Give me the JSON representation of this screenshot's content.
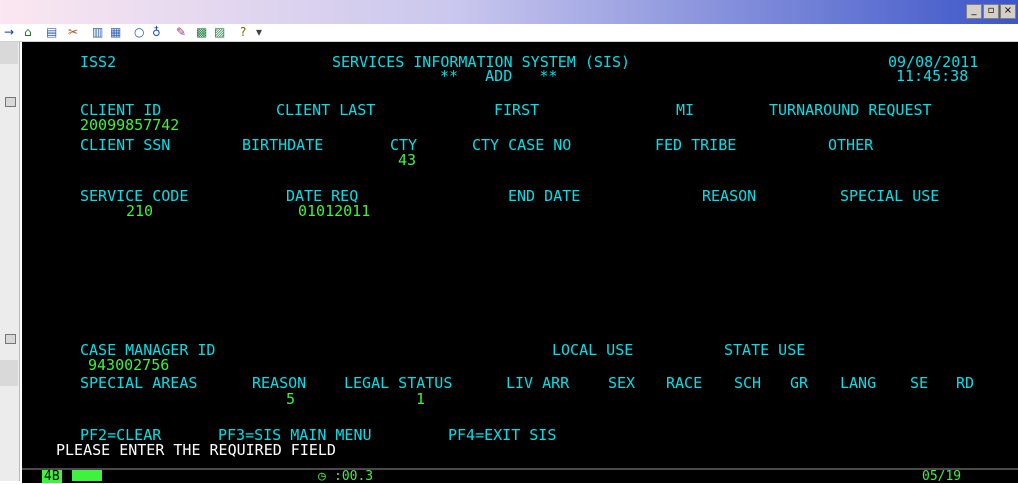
{
  "window": {
    "controls": [
      "_",
      "▫",
      "×"
    ]
  },
  "toolbar": {
    "icons": [
      "back-arrow-icon",
      "home-icon",
      "new-icon",
      "tools-icon",
      "copy-icon",
      "paste-icon",
      "circle-icon",
      "globe-icon",
      "edit-icon",
      "chart-icon",
      "chart2-icon",
      "help-icon",
      "dropdown-icon"
    ],
    "glyphs": [
      "→",
      "⌂",
      "▤",
      "✂",
      "▥",
      "▦",
      "○",
      "♁",
      "✎",
      "▩",
      "▨",
      "?",
      "▾"
    ]
  },
  "colors": {
    "label": "#00e0e8",
    "value": "#3ef23e",
    "message": "#ffffff",
    "screen_bg": "#000000"
  },
  "header": {
    "screen_id": "ISS2",
    "system_title": "SERVICES INFORMATION SYSTEM (SIS)",
    "mode": "**   ADD   **",
    "date": "09/08/2011",
    "time": "11:45:38"
  },
  "client": {
    "id_label": "CLIENT ID",
    "id_value": "20099857742",
    "last_label": "CLIENT LAST",
    "first_label": "FIRST",
    "mi_label": "MI",
    "turnaround_label": "TURNAROUND REQUEST",
    "ssn_label": "CLIENT SSN",
    "birthdate_label": "BIRTHDATE",
    "cty_label": "CTY",
    "cty_value": "43",
    "cty_case_label": "CTY CASE NO",
    "fed_tribe_label": "FED TRIBE",
    "other_label": "OTHER"
  },
  "service": {
    "code_label": "SERVICE CODE",
    "code_value": "210",
    "date_req_label": "DATE REQ",
    "date_req_value": "01012011",
    "end_date_label": "END DATE",
    "reason_label": "REASON",
    "special_use_label": "SPECIAL USE"
  },
  "case": {
    "manager_label": "CASE MANAGER ID",
    "manager_value": "943002756",
    "local_use_label": "LOCAL USE",
    "state_use_label": "STATE USE"
  },
  "areas": {
    "special_areas_label": "SPECIAL AREAS",
    "reason_label": "REASON",
    "reason_value": "5",
    "legal_status_label": "LEGAL STATUS",
    "legal_status_value": "1",
    "liv_arr_label": "LIV ARR",
    "sex_label": "SEX",
    "race_label": "RACE",
    "sch_label": "SCH",
    "gr_label": "GR",
    "lang_label": "LANG",
    "se_label": "SE",
    "rd_label": "RD"
  },
  "keys": {
    "pf2": "PF2=CLEAR",
    "pf3": "PF3=SIS MAIN MENU",
    "pf4": "PF4=EXIT SIS"
  },
  "message": "PLEASE ENTER THE REQUIRED FIELD",
  "status": {
    "session": "4B",
    "timer": ":00.3",
    "cursor_pos": "05/19"
  }
}
